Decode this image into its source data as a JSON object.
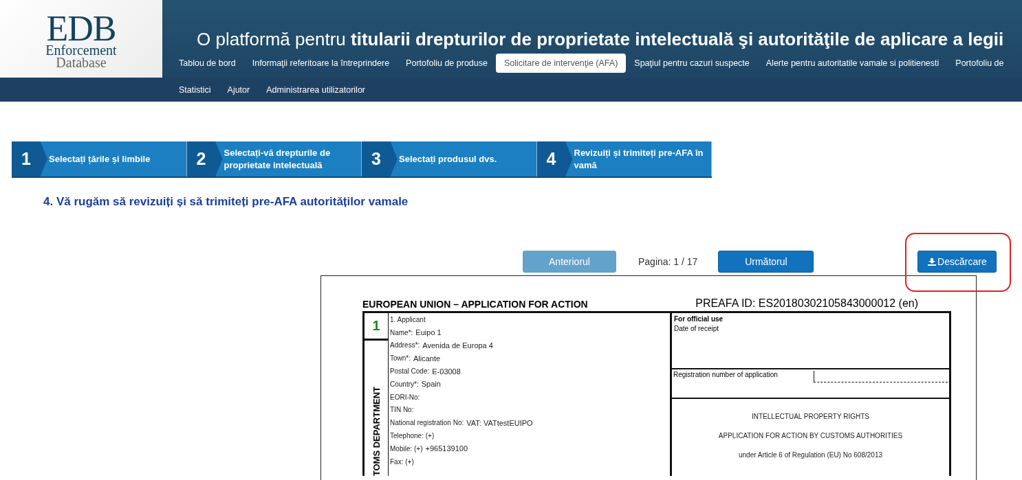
{
  "header": {
    "logo": {
      "acronym": "EDB",
      "line1": "Enforcement",
      "line2": "Database"
    },
    "title": "O platformă pentru **titularii drepturilor de proprietate intelectuală şi autorităţile de aplicare a legii**"
  },
  "nav_rows": [
    [
      {
        "label": "Tablou de bord",
        "selected": false
      },
      {
        "label": "Informaţii referitoare la întreprindere",
        "selected": false
      },
      {
        "label": "Portofoliu de produse",
        "selected": false
      },
      {
        "label": "Solicitare de intervenţie (AFA)",
        "selected": true
      },
      {
        "label": "Spaţiul pentru cazuri suspecte",
        "selected": false
      },
      {
        "label": "Alerte pentru autoritatile vamale si politienesti",
        "selected": false
      },
      {
        "label": "Portofoliu de",
        "selected": false
      }
    ],
    [
      {
        "label": "Statistici",
        "selected": false
      },
      {
        "label": "Ajutor",
        "selected": false
      },
      {
        "label": "Administrarea utilizatorilor",
        "selected": false
      }
    ]
  ],
  "steps": [
    {
      "number": "1",
      "label": "Selectați țările și limbile"
    },
    {
      "number": "2",
      "label": "Selectați-vă drepturile de proprietate intelectuală"
    },
    {
      "number": "3",
      "label": "Selectați produsul dvs."
    },
    {
      "number": "4",
      "label": "Revizuiți și trimiteți pre-AFA în vamă"
    }
  ],
  "heading": "4. Vă rugăm să revizuiți și să trimiteți pre-AFA autorităților vamale",
  "pager": {
    "previous": {
      "label": "Anteriorul",
      "disabled": true
    },
    "page_label": "Pagina: 1 / 17",
    "next": {
      "label": "Următorul",
      "disabled": false
    },
    "download": {
      "label": "Descărcare",
      "highlighted": true
    }
  },
  "document": {
    "title": "EUROPEAN UNION – APPLICATION FOR ACTION",
    "id": "PREAFA ID: ES20180302105843000012 (en)",
    "section_number": "1",
    "side_label": "TOMS DEPARTMENT",
    "applicant": {
      "heading": "1. Applicant",
      "fields": [
        {
          "label": "Name*:",
          "value": "Euipo 1"
        },
        {
          "label": "Address*:",
          "value": "Avenida de Europa 4"
        },
        {
          "label": "Town*:",
          "value": "Alicante"
        },
        {
          "label": "Postal Code:",
          "value": "E-03008"
        },
        {
          "label": "Country*:",
          "value": "Spain"
        },
        {
          "label": "EORI-No:"
        },
        {
          "label": "TIN No:"
        },
        {
          "label": "National registration No:",
          "value": "VAT: VATtestEUIPO"
        },
        {
          "label": "Telephone: (+)"
        },
        {
          "label": "Mobile: (+)",
          "value": "+965139100"
        },
        {
          "label": "Fax: (+)"
        }
      ]
    },
    "official": {
      "heading": "For official use",
      "date_label": "Date of receipt",
      "registration_label": "Registration number of application",
      "lines": [
        "INTELLECTUAL PROPERTY RIGHTS",
        "APPLICATION FOR ACTION BY CUSTOMS AUTHORITIES",
        "under Article 6 of Regulation (EU) No 608/2013"
      ]
    }
  }
}
